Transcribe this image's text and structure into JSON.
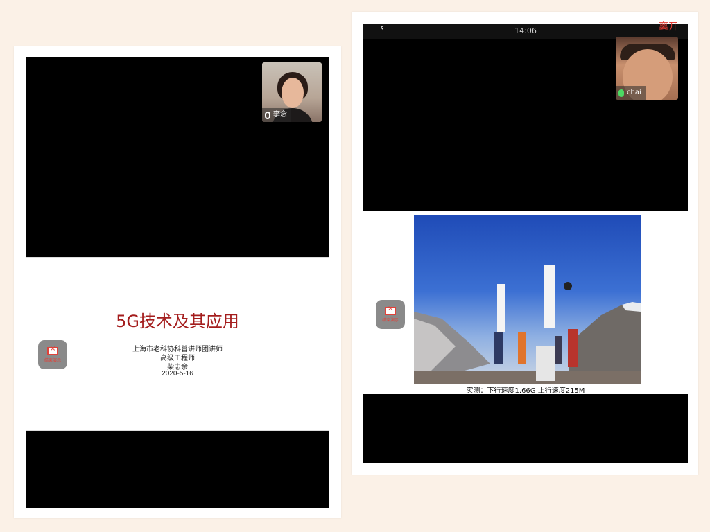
{
  "left_panel": {
    "participant_name": "李念",
    "float_button_label": "结束演示",
    "slide": {
      "title": "5G技术及其应用",
      "lines": [
        "上海市老科协科普讲师团讲师",
        "高级工程师",
        "柴忠余",
        "2020-5-16"
      ]
    }
  },
  "right_panel": {
    "status_time": "14:06",
    "status_left": "‹",
    "status_right": "离开",
    "participant_name": "chai",
    "float_button_label": "结束演示",
    "slide": {
      "caption": "实测：下行速度1.66G    上行速度215M",
      "photo_description_icons": [
        "antenna-mast-icon",
        "mountain-icon"
      ]
    }
  },
  "colors": {
    "background": "#fbf1e7",
    "title_red": "#a41d1d",
    "mic_green": "#4cd964"
  }
}
